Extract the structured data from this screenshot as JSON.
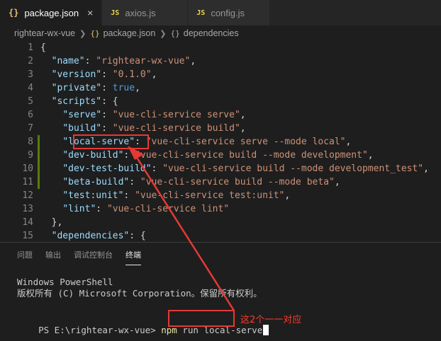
{
  "tabs": [
    {
      "icon": "{}",
      "label": "package.json",
      "active": true
    },
    {
      "icon": "JS",
      "label": "axios.js",
      "active": false
    },
    {
      "icon": "JS",
      "label": "config.js",
      "active": false
    }
  ],
  "close_glyph": "×",
  "breadcrumb": {
    "project": "rightear-wx-vue",
    "file": "package.json",
    "symbol": "dependencies"
  },
  "editor_lines": [
    {
      "n": "1",
      "parts": [
        [
          "p",
          "{"
        ]
      ]
    },
    {
      "n": "2",
      "parts": [
        [
          "p",
          "  "
        ],
        [
          "k",
          "\"name\""
        ],
        [
          "p",
          ": "
        ],
        [
          "s",
          "\"rightear-wx-vue\""
        ],
        [
          "p",
          ","
        ]
      ]
    },
    {
      "n": "3",
      "parts": [
        [
          "p",
          "  "
        ],
        [
          "k",
          "\"version\""
        ],
        [
          "p",
          ": "
        ],
        [
          "s",
          "\"0.1.0\""
        ],
        [
          "p",
          ","
        ]
      ]
    },
    {
      "n": "4",
      "parts": [
        [
          "p",
          "  "
        ],
        [
          "k",
          "\"private\""
        ],
        [
          "p",
          ": "
        ],
        [
          "b",
          "true"
        ],
        [
          "p",
          ","
        ]
      ]
    },
    {
      "n": "5",
      "parts": [
        [
          "p",
          "  "
        ],
        [
          "k",
          "\"scripts\""
        ],
        [
          "p",
          ": {"
        ]
      ]
    },
    {
      "n": "6",
      "parts": [
        [
          "p",
          "    "
        ],
        [
          "k",
          "\"serve\""
        ],
        [
          "p",
          ": "
        ],
        [
          "s",
          "\"vue-cli-service serve\""
        ],
        [
          "p",
          ","
        ]
      ]
    },
    {
      "n": "7",
      "parts": [
        [
          "p",
          "    "
        ],
        [
          "k",
          "\"build\""
        ],
        [
          "p",
          ": "
        ],
        [
          "s",
          "\"vue-cli-service build\""
        ],
        [
          "p",
          ","
        ]
      ]
    },
    {
      "n": "8",
      "parts": [
        [
          "p",
          "    "
        ],
        [
          "k",
          "\"local-serve\""
        ],
        [
          "p",
          ": "
        ],
        [
          "s",
          "\"vue-cli-service serve --mode local\""
        ],
        [
          "p",
          ","
        ]
      ]
    },
    {
      "n": "9",
      "parts": [
        [
          "p",
          "    "
        ],
        [
          "k",
          "\"dev-build\""
        ],
        [
          "p",
          ": "
        ],
        [
          "s",
          "\"vue-cli-service build --mode development\""
        ],
        [
          "p",
          ","
        ]
      ]
    },
    {
      "n": "10",
      "parts": [
        [
          "p",
          "    "
        ],
        [
          "k",
          "\"dev-test-build\""
        ],
        [
          "p",
          ": "
        ],
        [
          "s",
          "\"vue-cli-service build --mode development_test\""
        ],
        [
          "p",
          ","
        ]
      ]
    },
    {
      "n": "11",
      "parts": [
        [
          "p",
          "    "
        ],
        [
          "k",
          "\"beta-build\""
        ],
        [
          "p",
          ": "
        ],
        [
          "s",
          "\"vue-cli-service build --mode beta\""
        ],
        [
          "p",
          ","
        ]
      ]
    },
    {
      "n": "12",
      "parts": [
        [
          "p",
          "    "
        ],
        [
          "k",
          "\"test:unit\""
        ],
        [
          "p",
          ": "
        ],
        [
          "s",
          "\"vue-cli-service test:unit\""
        ],
        [
          "p",
          ","
        ]
      ]
    },
    {
      "n": "13",
      "parts": [
        [
          "p",
          "    "
        ],
        [
          "k",
          "\"lint\""
        ],
        [
          "p",
          ": "
        ],
        [
          "s",
          "\"vue-cli-service lint\""
        ]
      ]
    },
    {
      "n": "14",
      "parts": [
        [
          "p",
          "  },"
        ]
      ]
    },
    {
      "n": "15",
      "parts": [
        [
          "p",
          "  "
        ],
        [
          "k",
          "\"dependencies\""
        ],
        [
          "p",
          ": "
        ],
        [
          "p",
          "{"
        ]
      ]
    }
  ],
  "modified_lines": [
    "8",
    "9",
    "10",
    "11"
  ],
  "panel": {
    "tabs": [
      "问题",
      "输出",
      "调试控制台",
      "终端"
    ],
    "active_tab": "终端",
    "terminal": {
      "line1": "Windows PowerShell",
      "line2": "版权所有 (C) Microsoft Corporation。保留所有权利。",
      "prompt": "PS E:\\rightear-wx-vue>",
      "cmd": "npm",
      "cmd_arg": "run",
      "cmd_script": "local-serve"
    }
  },
  "annotation": "这2个一一对应",
  "colors": {
    "key": "#9cdcfe",
    "string": "#ce9178",
    "boolean": "#569cd6",
    "annotation": "#e53935",
    "modified_gutter": "#587c0c"
  }
}
